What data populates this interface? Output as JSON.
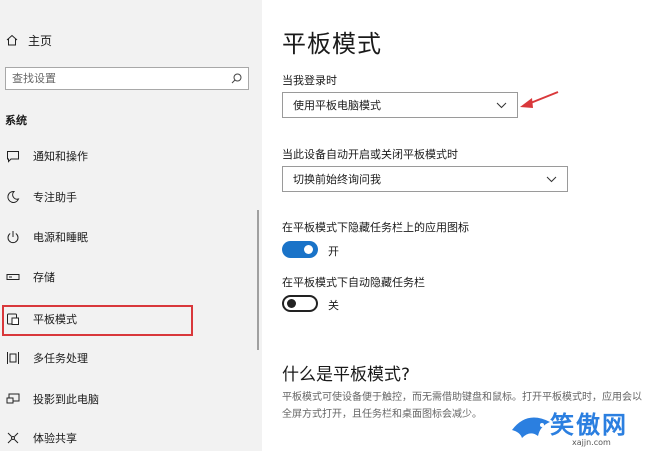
{
  "sidebar": {
    "home_label": "主页",
    "search_placeholder": "查找设置",
    "section_title": "系统",
    "items": [
      {
        "label": "通知和操作",
        "icon": "notification-icon"
      },
      {
        "label": "专注助手",
        "icon": "moon-icon"
      },
      {
        "label": "电源和睡眠",
        "icon": "power-icon"
      },
      {
        "label": "存储",
        "icon": "storage-icon"
      },
      {
        "label": "平板模式",
        "icon": "tablet-mode-icon",
        "selected": true
      },
      {
        "label": "多任务处理",
        "icon": "multitasking-icon"
      },
      {
        "label": "投影到此电脑",
        "icon": "projecting-icon"
      },
      {
        "label": "体验共享",
        "icon": "shared-experiences-icon"
      }
    ]
  },
  "main": {
    "title": "平板模式",
    "signin_label": "当我登录时",
    "signin_value": "使用平板电脑模式",
    "auto_switch_label": "当此设备自动开启或关闭平板模式时",
    "auto_switch_value": "切换前始终询问我",
    "hide_icons_label": "在平板模式下隐藏任务栏上的应用图标",
    "hide_icons_state": "开",
    "hide_icons_on": true,
    "auto_hide_label": "在平板模式下自动隐藏任务栏",
    "auto_hide_state": "关",
    "auto_hide_on": false,
    "what_is_title": "什么是平板模式?",
    "description": "平板模式可使设备便于触控，而无需借助键盘和鼠标。打开平板模式时，应用会以全屏方式打开，且任务栏和桌面图标会减少。"
  },
  "colors": {
    "accent": "#1a73c8",
    "highlight": "#d9383b",
    "sidebar_bg": "#f2f2f2"
  },
  "watermark": {
    "text": "笑傲网",
    "url": "xajjn.com"
  }
}
